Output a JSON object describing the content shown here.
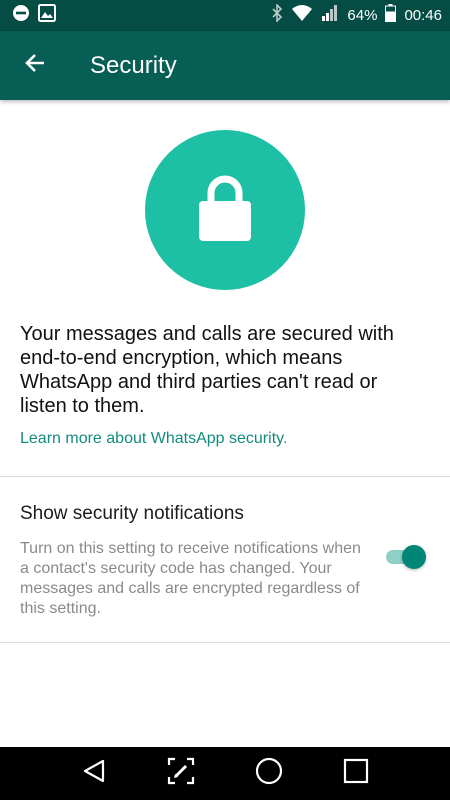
{
  "status_bar": {
    "battery_percent": "64%",
    "time": "00:46",
    "icons": [
      "dnd-icon",
      "gallery-icon",
      "bluetooth-icon",
      "wifi-icon",
      "signal-icon",
      "battery-icon"
    ]
  },
  "app_bar": {
    "title": "Security",
    "back_icon": "arrow-left-icon",
    "color": "#075e54"
  },
  "main": {
    "hero_icon": "lock-icon",
    "hero_color": "#1dbfa5",
    "description": "Your messages and calls are secured with end-to-end encryption, which means WhatsApp and third parties can't read or listen to them.",
    "learn_more_link": "Learn more about WhatsApp security."
  },
  "settings": {
    "security_notifications": {
      "title": "Show security notifications",
      "description": "Turn on this setting to receive notifications when a contact's security code has changed. Your messages and calls are encrypted regardless of this setting.",
      "enabled": true
    }
  },
  "nav_bar": {
    "buttons": [
      "back-triangle-icon",
      "capture-icon",
      "home-circle-icon",
      "recents-square-icon"
    ]
  }
}
